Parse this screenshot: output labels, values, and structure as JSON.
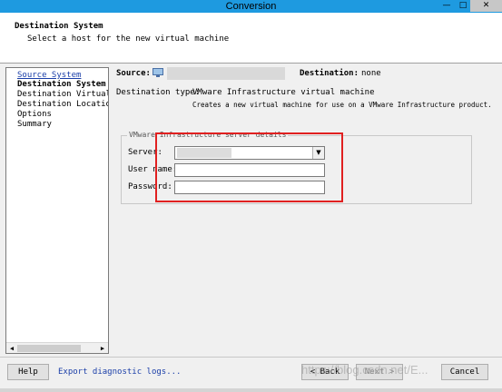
{
  "window": {
    "title": "Conversion",
    "controls": {
      "minimize": "—",
      "maximize": "□",
      "close": "✕"
    }
  },
  "header": {
    "title": "Destination System",
    "subtitle": "Select a host for the new virtual machine"
  },
  "steps": [
    {
      "label": "Source System",
      "state": "link"
    },
    {
      "label": "Destination System",
      "state": "current"
    },
    {
      "label": "Destination Virtual M",
      "state": "normal"
    },
    {
      "label": "Destination Location",
      "state": "normal"
    },
    {
      "label": "Options",
      "state": "normal"
    },
    {
      "label": "Summary",
      "state": "normal"
    }
  ],
  "summary": {
    "source_label": "Source:",
    "destination_label": "Destination:",
    "destination_value": "none"
  },
  "destination_type": {
    "label": "Destination type:",
    "value": "VMware Infrastructure virtual machine",
    "description": "Creates a new virtual machine for use on a VMware Infrastructure product."
  },
  "server_details": {
    "legend": "VMware Infrastructure server details",
    "server_label": "Server:",
    "username_label": "User name:",
    "username_value": "",
    "password_label": "Password:",
    "password_value": ""
  },
  "footer": {
    "help": "Help",
    "export_link": "Export diagnostic logs...",
    "back": "< Back",
    "next": "Next >",
    "cancel": "Cancel",
    "watermark": "https://blog.csdn.net/E..."
  },
  "colors": {
    "titlebar": "#1e9ae0",
    "link": "#1a3ea8",
    "highlight": "#e02020"
  }
}
